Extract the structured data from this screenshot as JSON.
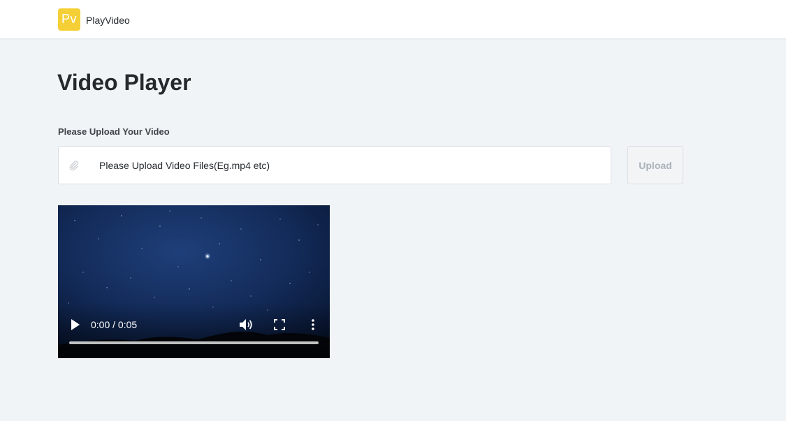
{
  "navbar": {
    "logo_text": "Pv",
    "brand": "PlayVideo",
    "logo_color": "#f5cf36"
  },
  "main": {
    "title": "Video Player",
    "upload_label": "Please Upload Your Video",
    "file_input": {
      "icon": "paperclip-icon",
      "placeholder": "Please Upload Video Files(Eg.mp4 etc)"
    },
    "upload_button": {
      "label": "Upload",
      "disabled": true
    }
  },
  "video_player": {
    "time": "0:00 / 0:05",
    "progress": 0,
    "controls": [
      "play-icon",
      "volume-icon",
      "fullscreen-icon",
      "more-vertical-icon"
    ]
  }
}
